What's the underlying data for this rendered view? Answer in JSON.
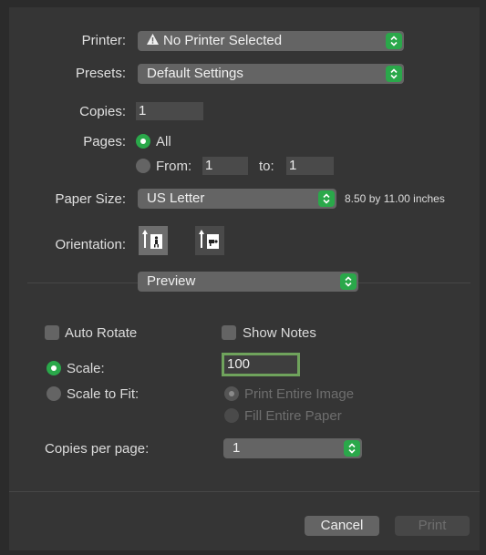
{
  "printer": {
    "label": "Printer:",
    "value": "No Printer Selected",
    "icon": "warning-icon"
  },
  "presets": {
    "label": "Presets:",
    "value": "Default Settings"
  },
  "copies": {
    "label": "Copies:",
    "value": "1"
  },
  "pages": {
    "label": "Pages:",
    "all_label": "All",
    "from_label": "From:",
    "from_value": "1",
    "to_label": "to:",
    "to_value": "1",
    "selected": "All"
  },
  "paper_size": {
    "label": "Paper Size:",
    "value": "US Letter",
    "dimensions": "8.50 by 11.00 inches"
  },
  "orientation": {
    "label": "Orientation:",
    "selected": "portrait"
  },
  "section": {
    "value": "Preview"
  },
  "options": {
    "auto_rotate": {
      "label": "Auto Rotate",
      "checked": false
    },
    "show_notes": {
      "label": "Show Notes",
      "checked": false
    },
    "scale": {
      "label": "Scale:",
      "value": "100",
      "selected": true
    },
    "scale_to_fit": {
      "label": "Scale to Fit:",
      "selected": false
    },
    "print_entire_image": {
      "label": "Print Entire Image",
      "disabled": true
    },
    "fill_entire_paper": {
      "label": "Fill Entire Paper",
      "disabled": true
    },
    "copies_per_page": {
      "label": "Copies per page:",
      "value": "1"
    }
  },
  "buttons": {
    "cancel": "Cancel",
    "print": "Print"
  },
  "colors": {
    "accent": "#2aa84a",
    "background": "#353535",
    "control": "#646464"
  }
}
